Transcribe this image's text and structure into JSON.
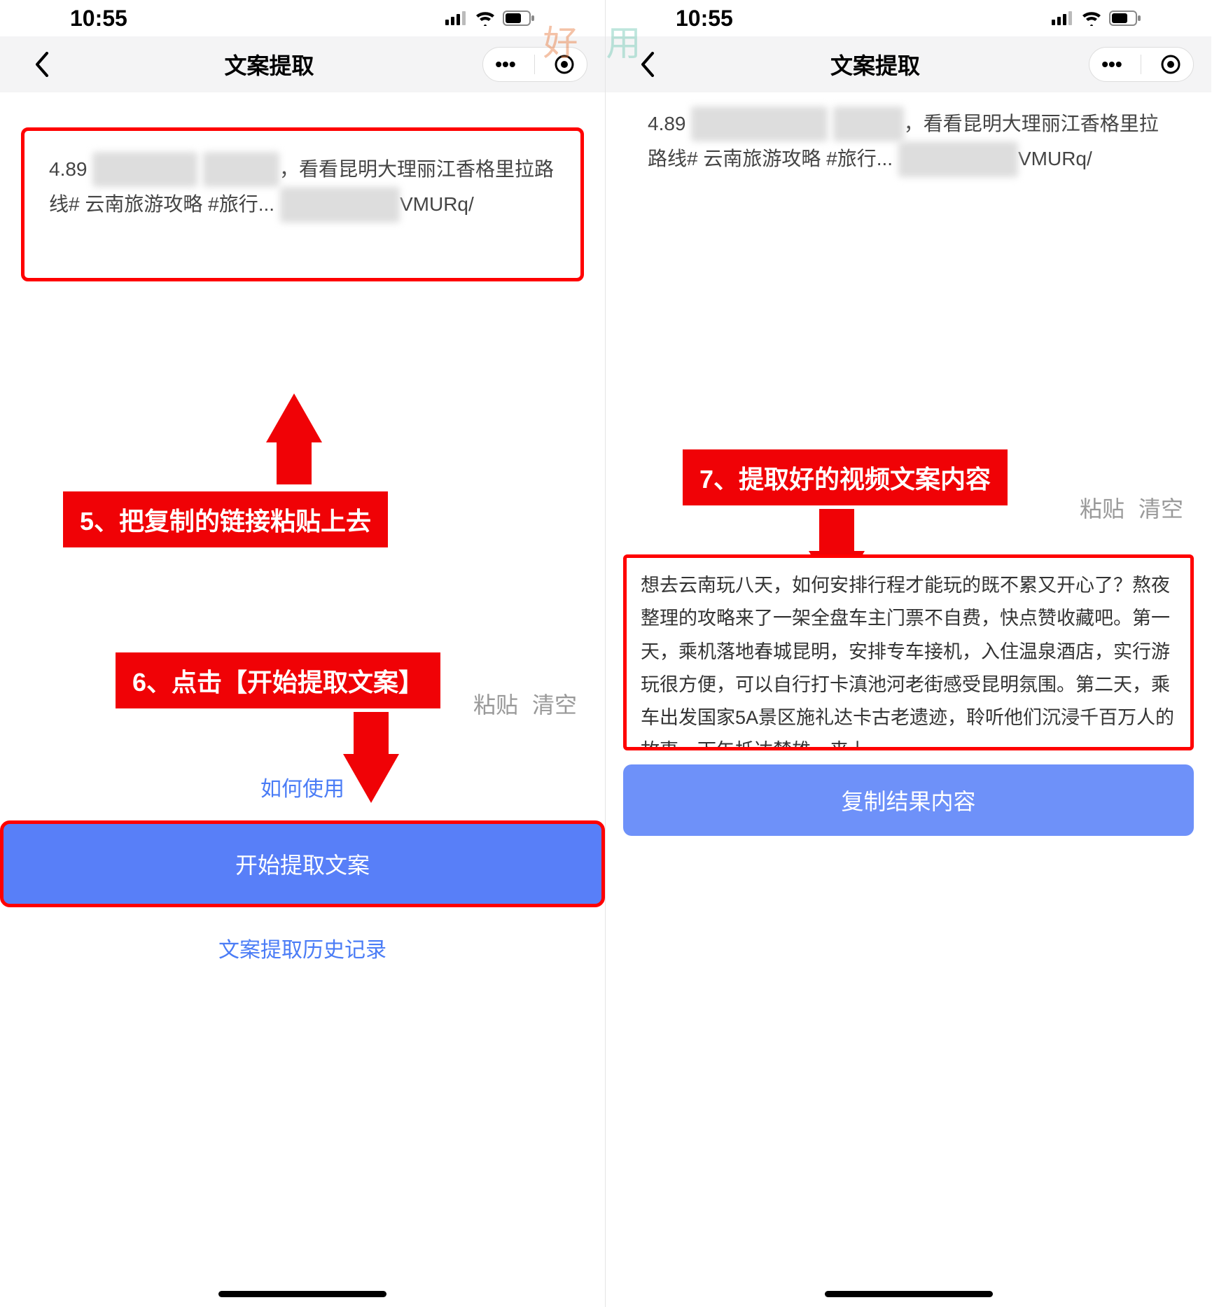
{
  "status": {
    "time": "10:55"
  },
  "nav": {
    "title": "文案提取"
  },
  "left": {
    "input_prefix": "4.89 ",
    "input_mid_label": "看看昆明大理丽江香格里拉路线# 云南旅游攻略 #旅行... ",
    "input_suffix": "VMURq/",
    "annotation5": "5、把复制的链接粘贴上去",
    "annotation6": "6、点击【开始提取文案】",
    "paste": "粘贴",
    "clear": "清空",
    "how_use": "如何使用",
    "primary_btn": "开始提取文案",
    "history": "文案提取历史记录"
  },
  "right": {
    "input_prefix": "4.89 ",
    "input_mid_label": "，看看昆明大理丽江香格里拉路线# 云南旅游攻略 #旅行... ",
    "input_suffix": "VMURq/",
    "annotation7": "7、提取好的视频文案内容",
    "paste": "粘贴",
    "clear": "清空",
    "result_text": "想去云南玩八天，如何安排行程才能玩的既不累又开心了？熬夜整理的攻略来了一架全盘车主门票不自费，快点赞收藏吧。第一天，乘机落地春城昆明，安排专车接机，入住温泉酒店，实行游玩很方便，可以自行打卡滇池河老街感受昆明氛围。第二天，乘车出发国家5A景区施礼达卡古老遗迹，聆听他们沉浸千百万人的故事。下午抵达楚雄，来上",
    "primary_btn": "复制结果内容"
  },
  "watermark": {
    "c1": "好",
    "c2": "用"
  }
}
